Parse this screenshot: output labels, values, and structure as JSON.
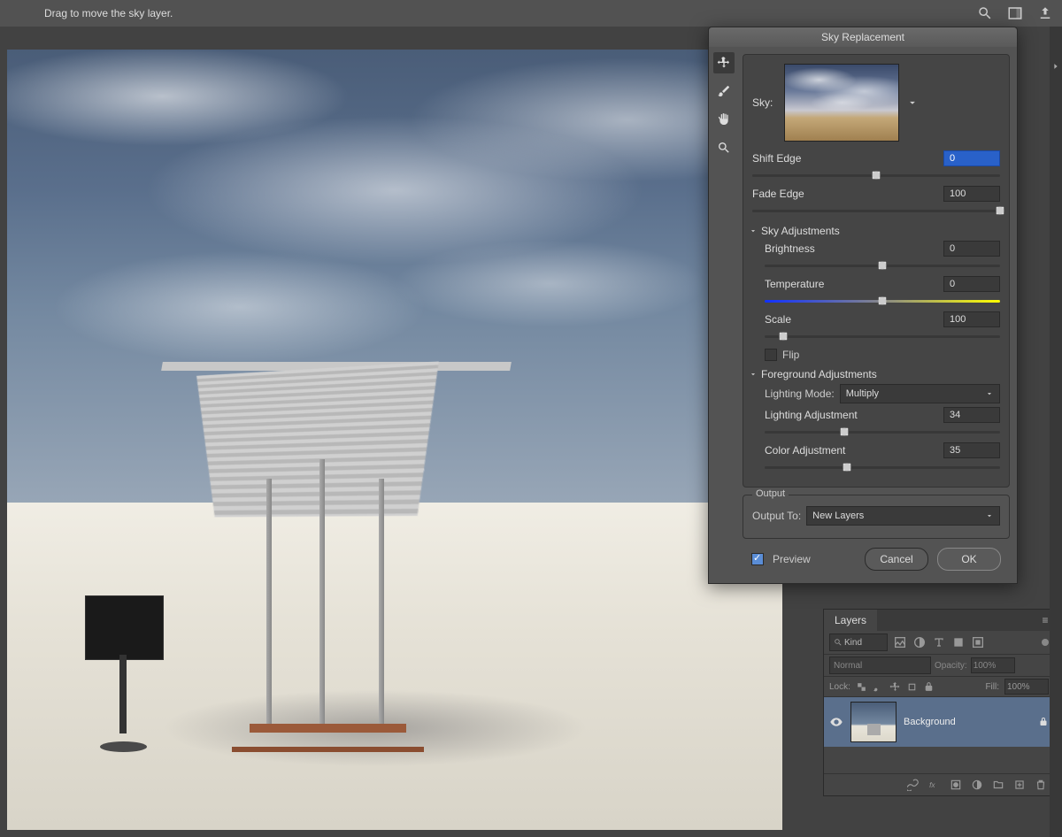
{
  "topbar": {
    "hint": "Drag to move the sky layer."
  },
  "dialog": {
    "title": "Sky Replacement",
    "sky_label": "Sky:",
    "shift_edge": {
      "label": "Shift Edge",
      "value": "0",
      "pos": 50
    },
    "fade_edge": {
      "label": "Fade Edge",
      "value": "100",
      "pos": 100
    },
    "sky_adj_header": "Sky Adjustments",
    "brightness": {
      "label": "Brightness",
      "value": "0",
      "pos": 50
    },
    "temperature": {
      "label": "Temperature",
      "value": "0",
      "pos": 50
    },
    "scale": {
      "label": "Scale",
      "value": "100",
      "pos": 8
    },
    "flip_label": "Flip",
    "flip_checked": false,
    "fg_header": "Foreground Adjustments",
    "lighting_mode_label": "Lighting Mode:",
    "lighting_mode_value": "Multiply",
    "lighting_adj": {
      "label": "Lighting Adjustment",
      "value": "34",
      "pos": 34
    },
    "color_adj": {
      "label": "Color Adjustment",
      "value": "35",
      "pos": 35
    },
    "output_legend": "Output",
    "output_to_label": "Output To:",
    "output_to_value": "New Layers",
    "preview_label": "Preview",
    "preview_checked": true,
    "cancel": "Cancel",
    "ok": "OK"
  },
  "layers": {
    "tab": "Layers",
    "kind": "Kind",
    "blend": "Normal",
    "opacity_label": "Opacity:",
    "opacity_value": "100%",
    "lock_label": "Lock:",
    "fill_label": "Fill:",
    "fill_value": "100%",
    "row_name": "Background"
  }
}
